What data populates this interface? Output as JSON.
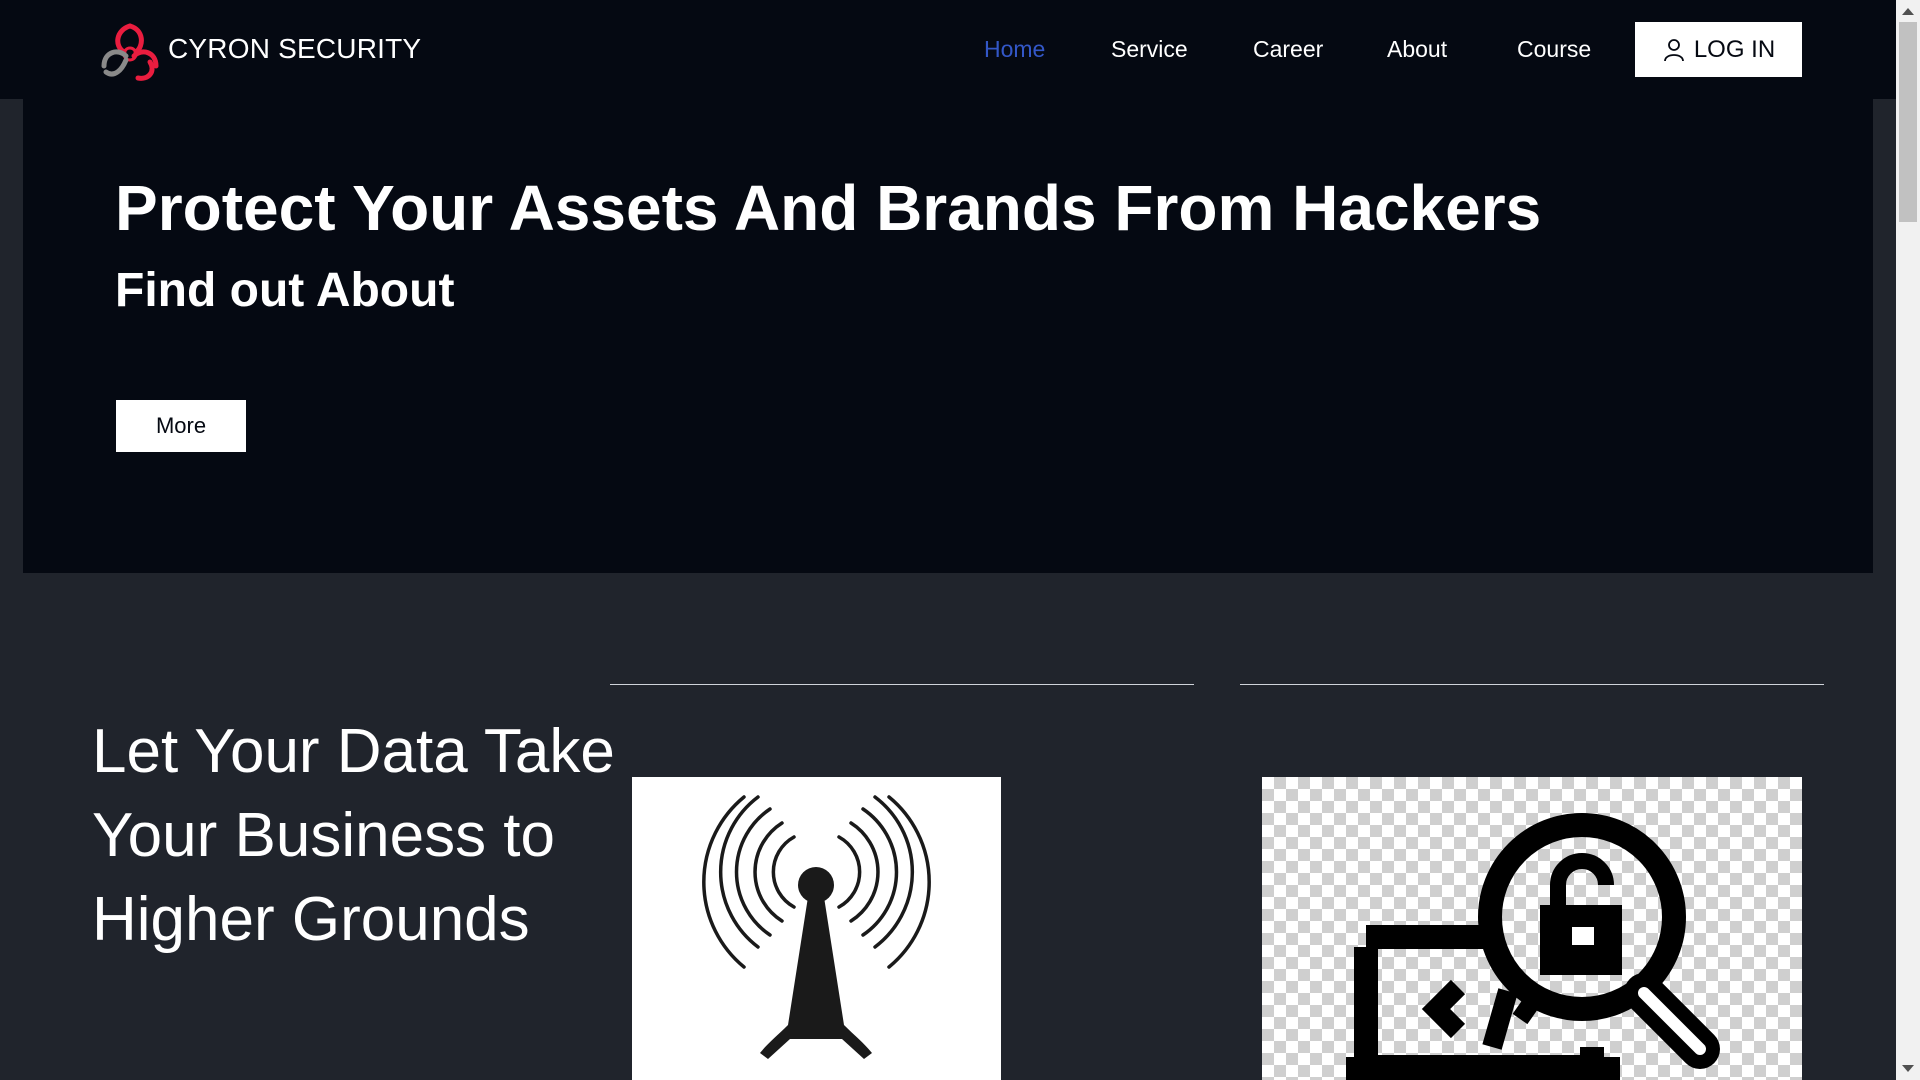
{
  "header": {
    "brand": "CYRON SECURITY",
    "logo_icon": "biohazard-logo-icon",
    "nav": [
      {
        "label": "Home",
        "active": true
      },
      {
        "label": "Service",
        "active": false
      },
      {
        "label": "Career",
        "active": false
      },
      {
        "label": "About",
        "active": false
      },
      {
        "label": "Course",
        "active": false
      }
    ],
    "login_label": "LOG IN",
    "login_icon": "user-icon",
    "active_color": "#3357c7"
  },
  "hero": {
    "title": "Protect Your Assets And Brands From Hackers",
    "subtitle": "Find out About",
    "button_label": "More",
    "background": "#050912"
  },
  "section": {
    "tagline_lines": [
      "Let Your Data Take",
      "Your Business to",
      "Higher Grounds"
    ],
    "images": [
      {
        "icon": "radio-tower-icon"
      },
      {
        "icon": "laptop-magnifier-lock-icon"
      }
    ],
    "background": "#20242c"
  }
}
